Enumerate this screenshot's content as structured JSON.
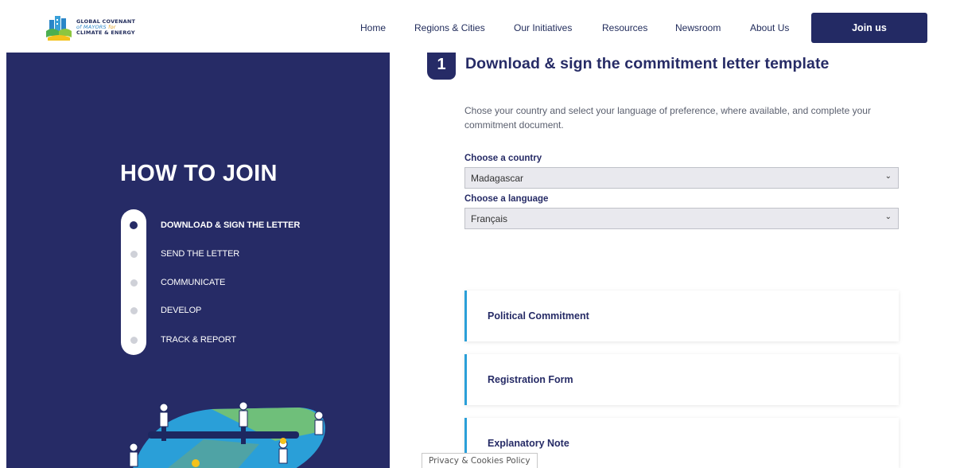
{
  "header": {
    "logo": {
      "line1": "GLOBAL COVENANT",
      "line2a": "of MAYORS",
      "line2b": " for",
      "line3": "CLIMATE & ENERGY"
    },
    "nav": [
      "Home",
      "Regions & Cities",
      "Our Initiatives",
      "Resources",
      "Newsroom",
      "About Us"
    ],
    "join_label": "Join us"
  },
  "left": {
    "title": "HOW TO JOIN",
    "steps": [
      {
        "label": "DOWNLOAD & SIGN THE LETTER",
        "active": true
      },
      {
        "label": "SEND THE LETTER",
        "active": false
      },
      {
        "label": "COMMUNICATE",
        "active": false
      },
      {
        "label": "DEVELOP",
        "active": false
      },
      {
        "label": "TRACK & REPORT",
        "active": false
      }
    ]
  },
  "main": {
    "step_number": "1",
    "title": "Download & sign the commitment letter template",
    "intro": "Chose your country and select your language of preference, where available, and complete your commitment document.",
    "country_label": "Choose a country",
    "country_value": "Madagascar",
    "language_label": "Choose a language",
    "language_value": "Français",
    "documents": [
      "Political Commitment",
      "Registration Form",
      "Explanatory Note"
    ]
  },
  "privacy_label": "Privacy & Cookies Policy",
  "colors": {
    "navy": "#262b66",
    "accent": "#2a9fd8",
    "join_button": "#232a64"
  }
}
